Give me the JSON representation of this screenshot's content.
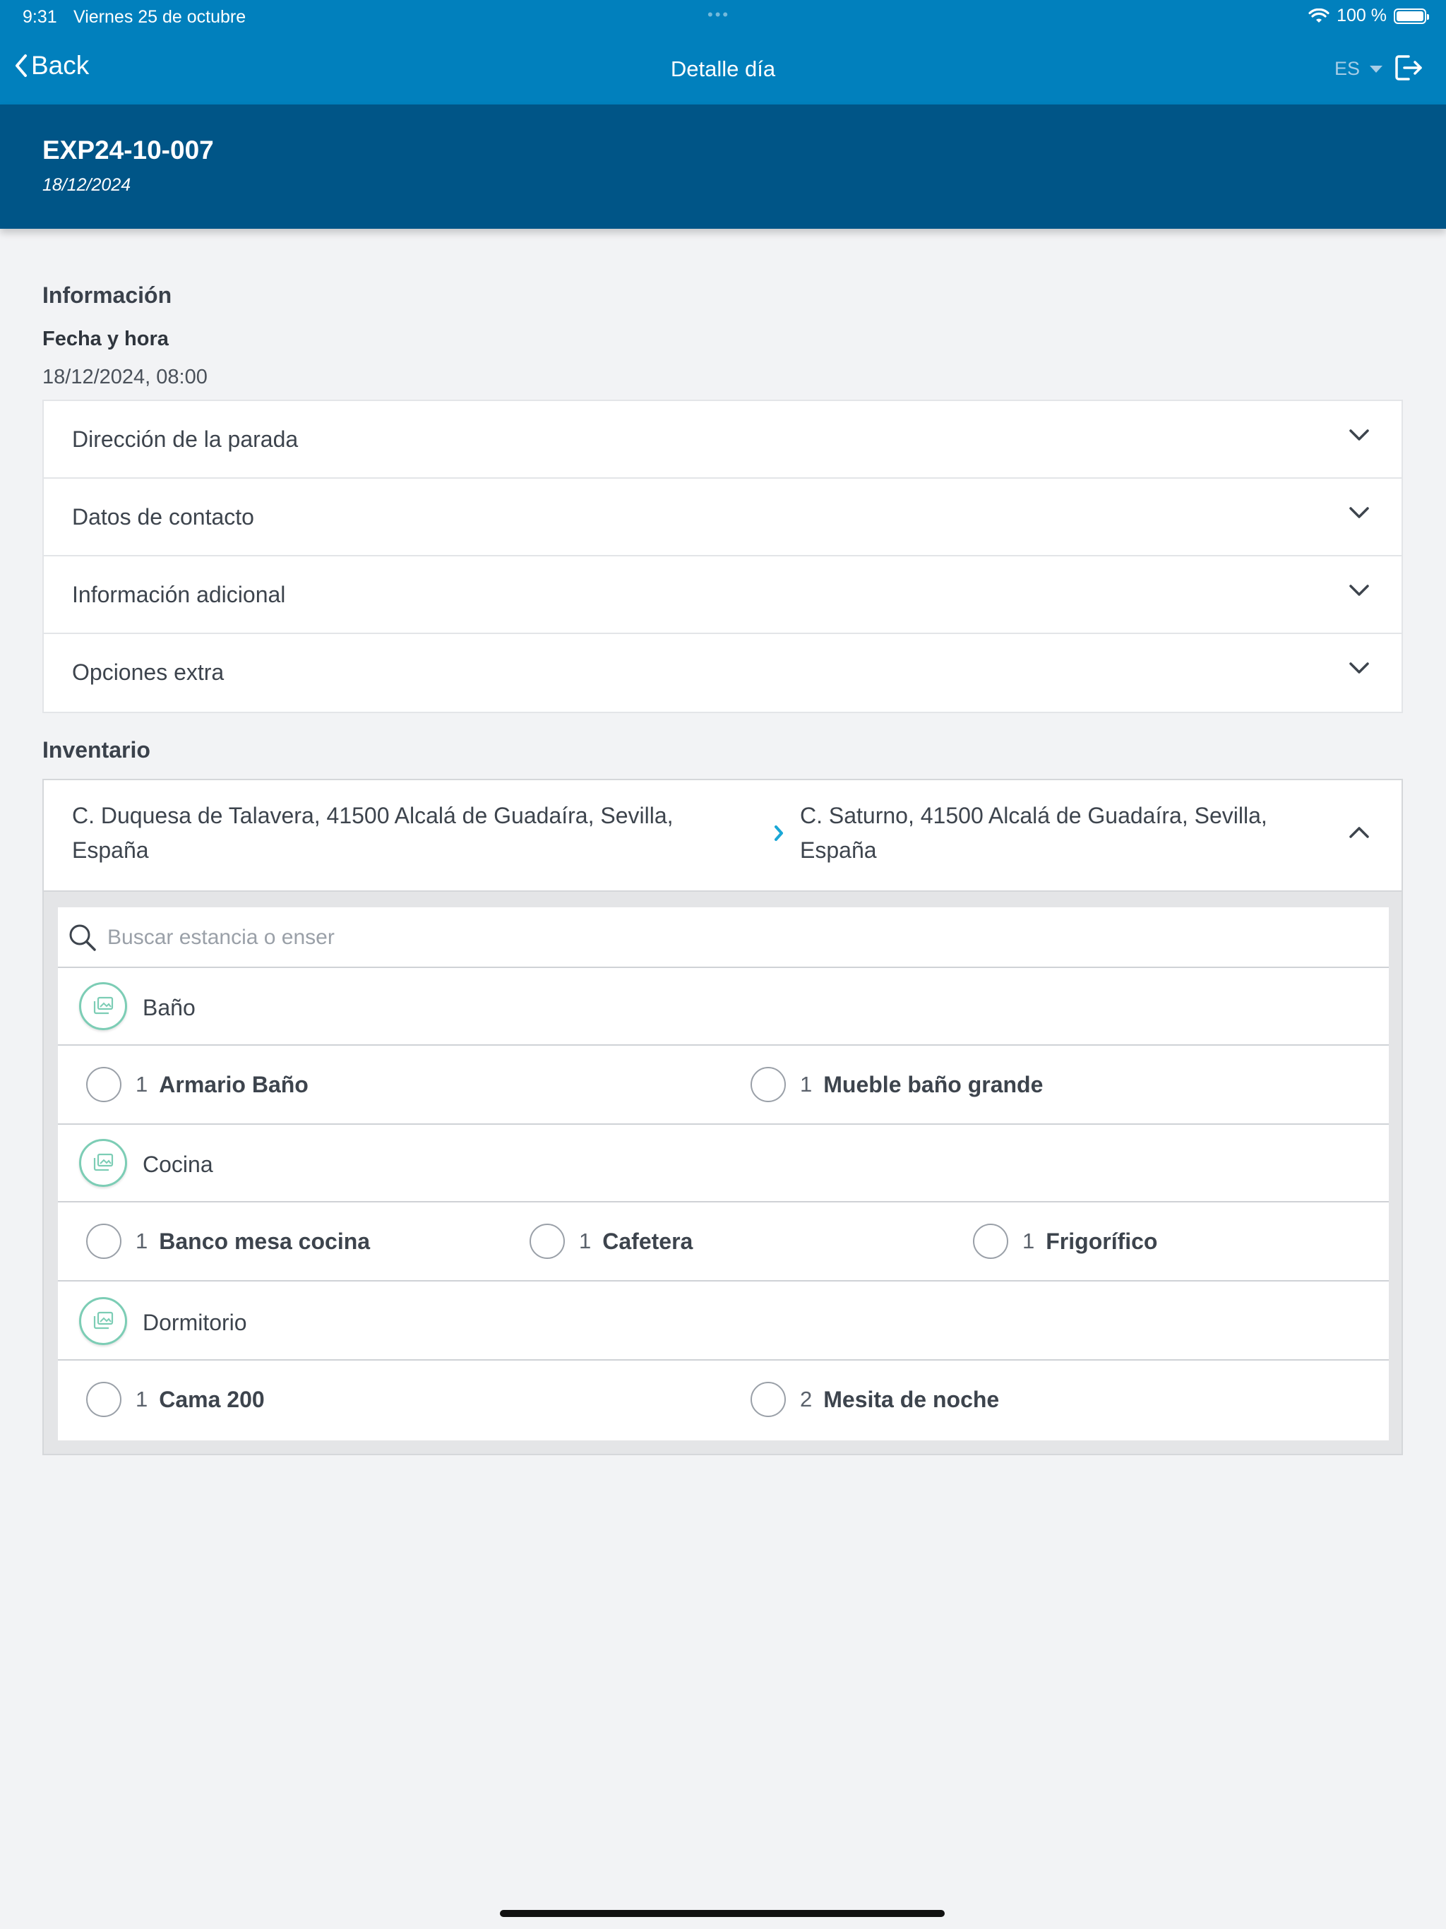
{
  "status_bar": {
    "time": "9:31",
    "date": "Viernes 25 de octubre",
    "battery": "100 %"
  },
  "nav": {
    "back_label": "Back",
    "title": "Detalle día",
    "language": "ES"
  },
  "header": {
    "code": "EXP24-10-007",
    "date": "18/12/2024"
  },
  "info": {
    "section_title": "Información",
    "datetime_label": "Fecha y hora",
    "datetime_value": "18/12/2024, 08:00",
    "accordion": [
      {
        "label": "Dirección de la parada"
      },
      {
        "label": "Datos de contacto"
      },
      {
        "label": "Información adicional"
      },
      {
        "label": "Opciones extra"
      }
    ]
  },
  "inventory": {
    "section_title": "Inventario",
    "from_address": "C. Duquesa de Talavera, 41500 Alcalá de Guadaíra, Sevilla, España",
    "to_address": "C. Saturno, 41500 Alcalá de Guadaíra, Sevilla, España",
    "search_placeholder": "Buscar estancia o enser",
    "rooms": [
      {
        "name": "Baño",
        "items": [
          {
            "qty": "1",
            "name": "Armario Baño"
          },
          {
            "qty": "1",
            "name": "Mueble baño grande"
          }
        ]
      },
      {
        "name": "Cocina",
        "items": [
          {
            "qty": "1",
            "name": "Banco mesa cocina"
          },
          {
            "qty": "1",
            "name": "Cafetera"
          },
          {
            "qty": "1",
            "name": "Frigorífico"
          }
        ]
      },
      {
        "name": "Dormitorio",
        "items": [
          {
            "qty": "1",
            "name": "Cama 200"
          },
          {
            "qty": "2",
            "name": "Mesita de noche"
          }
        ]
      }
    ]
  },
  "colors": {
    "nav_blue": "#0180bd",
    "header_blue": "#005587",
    "accent_teal": "#7ccdb5",
    "arrow_cyan": "#1aa7d6",
    "background": "#f2f3f5"
  },
  "icons": {
    "back": "chevron-left-icon",
    "language_caret": "caret-down-icon",
    "logout": "logout-icon",
    "accordion": "chevron-down-icon",
    "route_arrow": "chevron-right-icon",
    "collapse": "chevron-up-icon",
    "search": "search-icon",
    "room": "gallery-icon",
    "select": "radio-icon"
  }
}
